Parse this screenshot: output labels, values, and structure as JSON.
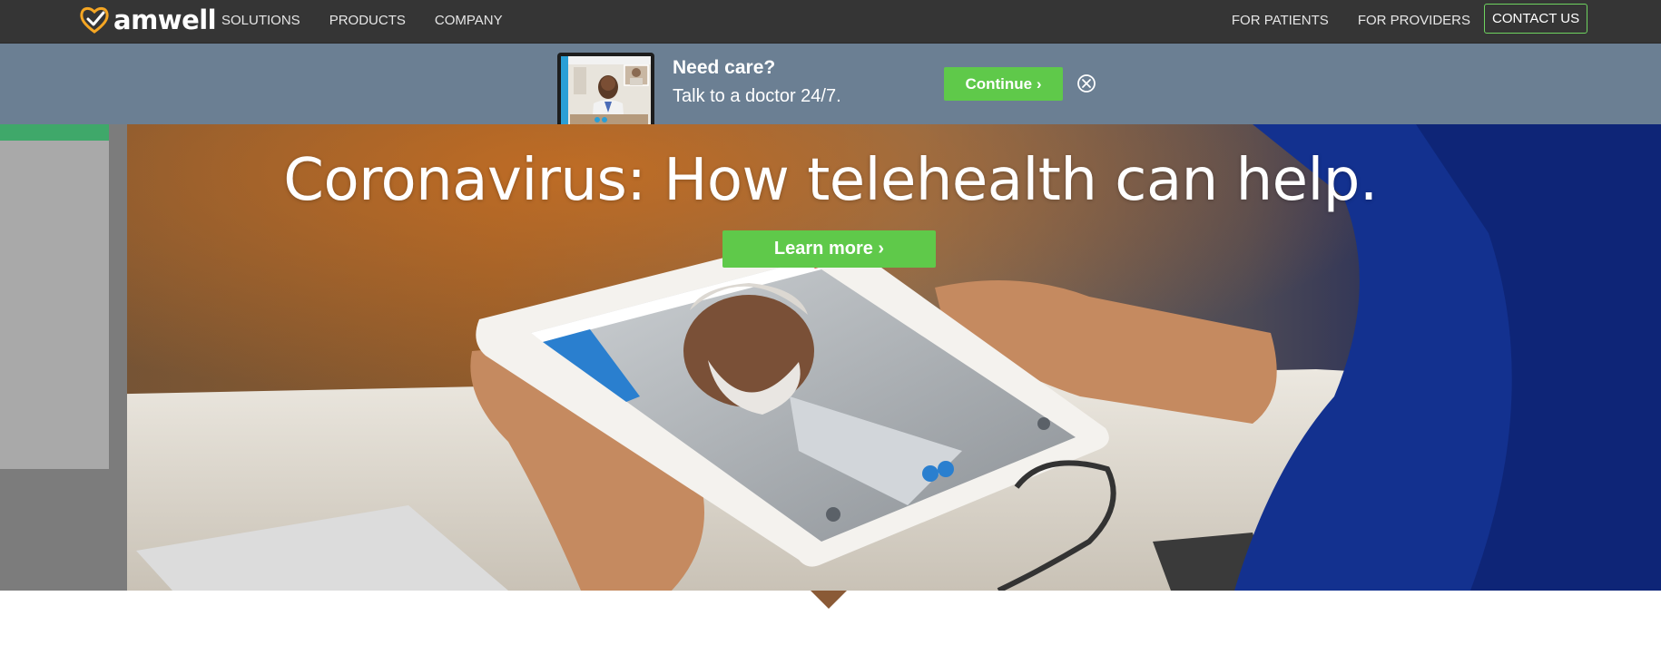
{
  "brand": {
    "name": "amwell",
    "logo_color": "#f5a623"
  },
  "nav": {
    "left_items": [
      {
        "label": "SOLUTIONS"
      },
      {
        "label": "PRODUCTS"
      },
      {
        "label": "COMPANY"
      }
    ],
    "right_items": [
      {
        "label": "FOR PATIENTS"
      },
      {
        "label": "FOR PROVIDERS"
      }
    ],
    "contact_label": "CONTACT US",
    "background": "#353535"
  },
  "promo": {
    "title": "Need care?",
    "subtitle": "Talk to a doctor 24/7.",
    "continue_label": "Continue ›",
    "close_icon": "close-circle-icon",
    "background": "#6b7f93"
  },
  "hero": {
    "headline": "Coronavirus: How telehealth can help.",
    "cta_label": "Learn more ›",
    "accent": "#5fc94a"
  }
}
